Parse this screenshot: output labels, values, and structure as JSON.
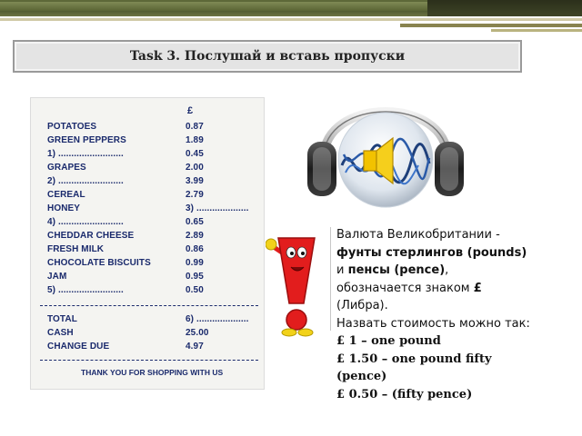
{
  "title": "Task 3. Послушай и вставь пропуски",
  "receipt": {
    "currency_symbol": "£",
    "items": [
      {
        "name": "POTATOES",
        "price": "0.87"
      },
      {
        "name": "GREEN PEPPERS",
        "price": "1.89"
      },
      {
        "name": "1) .........................",
        "price": "0.45"
      },
      {
        "name": "GRAPES",
        "price": "2.00"
      },
      {
        "name": "2) .........................",
        "price": "3.99"
      },
      {
        "name": "CEREAL",
        "price": "2.79"
      },
      {
        "name": "HONEY",
        "price": "3) ...................."
      },
      {
        "name": "4) .........................",
        "price": "0.65"
      },
      {
        "name": "CHEDDAR CHEESE",
        "price": "2.89"
      },
      {
        "name": "FRESH MILK",
        "price": "0.86"
      },
      {
        "name": "CHOCOLATE BISCUITS",
        "price": "0.99"
      },
      {
        "name": "JAM",
        "price": "0.95"
      },
      {
        "name": "5) .........................",
        "price": "0.50"
      }
    ],
    "totals": [
      {
        "name": "TOTAL",
        "price": "6) ...................."
      },
      {
        "name": "CASH",
        "price": "25.00"
      },
      {
        "name": "CHANGE DUE",
        "price": "4.97"
      }
    ],
    "thanks": "THANK YOU  FOR  SHOPPING WITH  US"
  },
  "info": {
    "line1": "Валюта Великобритании -",
    "line2": "фунты стерлингов (pounds)",
    "line3_a": "и ",
    "line3_b": "пенсы (pence)",
    "line3_c": ",",
    "line4_a": "обозначается знаком ",
    "line4_b": "£",
    "line5": "(Либра).",
    "line6": "Назвать стоимость можно так:",
    "line7": "£ 1 – one pound",
    "line8": "£ 1.50 – one pound fifty",
    "line9": "(pence)",
    "line10": "£ 0.50 – (fifty pence)"
  },
  "colors": {
    "receipt_ink": "#1a2a6c",
    "mascot_red": "#e21d1d",
    "speaker_yellow": "#f2c200"
  },
  "icons": [
    "headphones-speaker-icon",
    "exclamation-mascot-icon"
  ]
}
